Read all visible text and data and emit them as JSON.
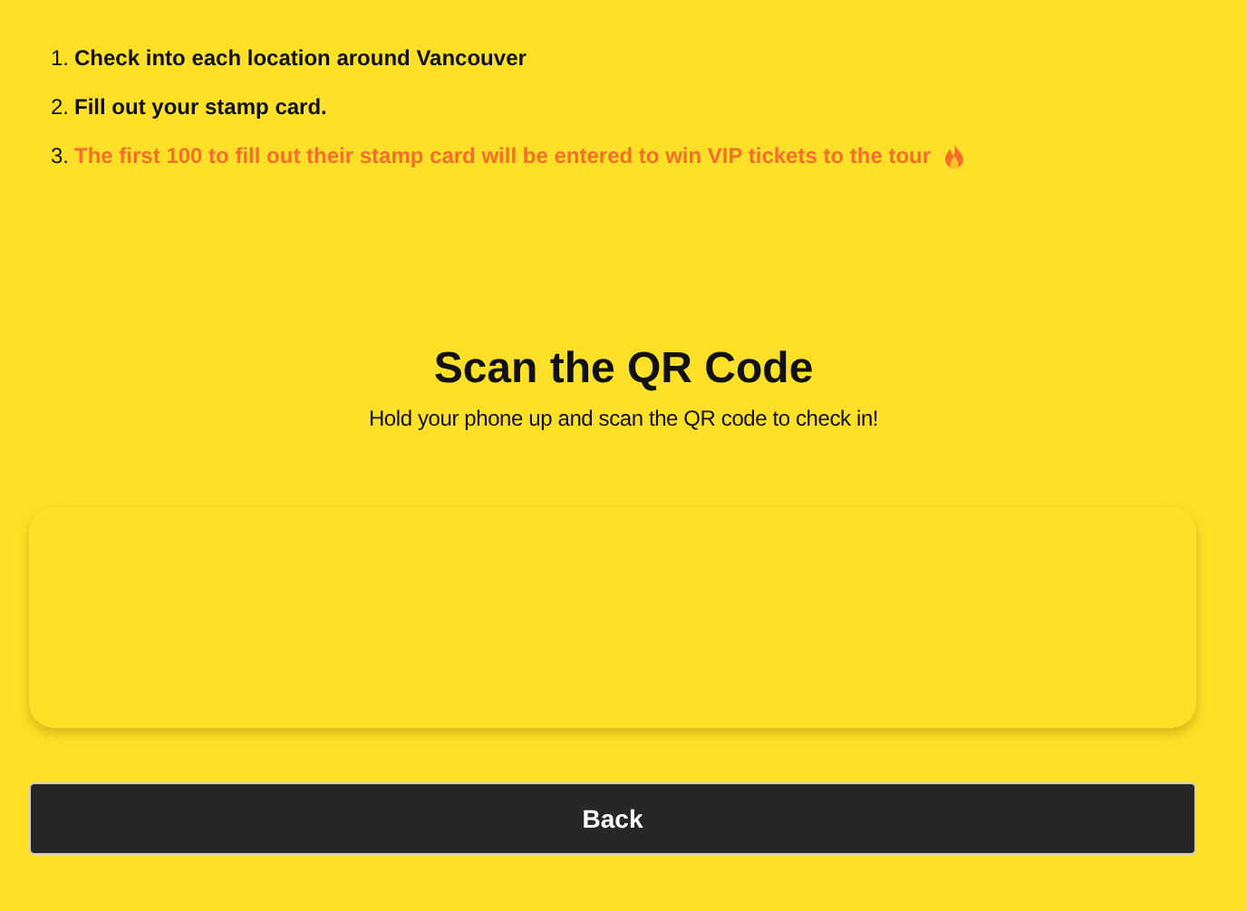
{
  "steps": [
    {
      "number": "1.",
      "text": "Check into each location around Vancouver",
      "highlighted": false
    },
    {
      "number": "2.",
      "text": "Fill out your stamp card.",
      "highlighted": false
    },
    {
      "number": "3.",
      "text": "The first 100 to fill out their stamp card will be entered to win VIP tickets to the tour",
      "highlighted": true
    }
  ],
  "scan": {
    "title": "Scan the QR Code",
    "subtitle": "Hold your phone up and scan the QR code to check in!"
  },
  "back_button": "Back"
}
